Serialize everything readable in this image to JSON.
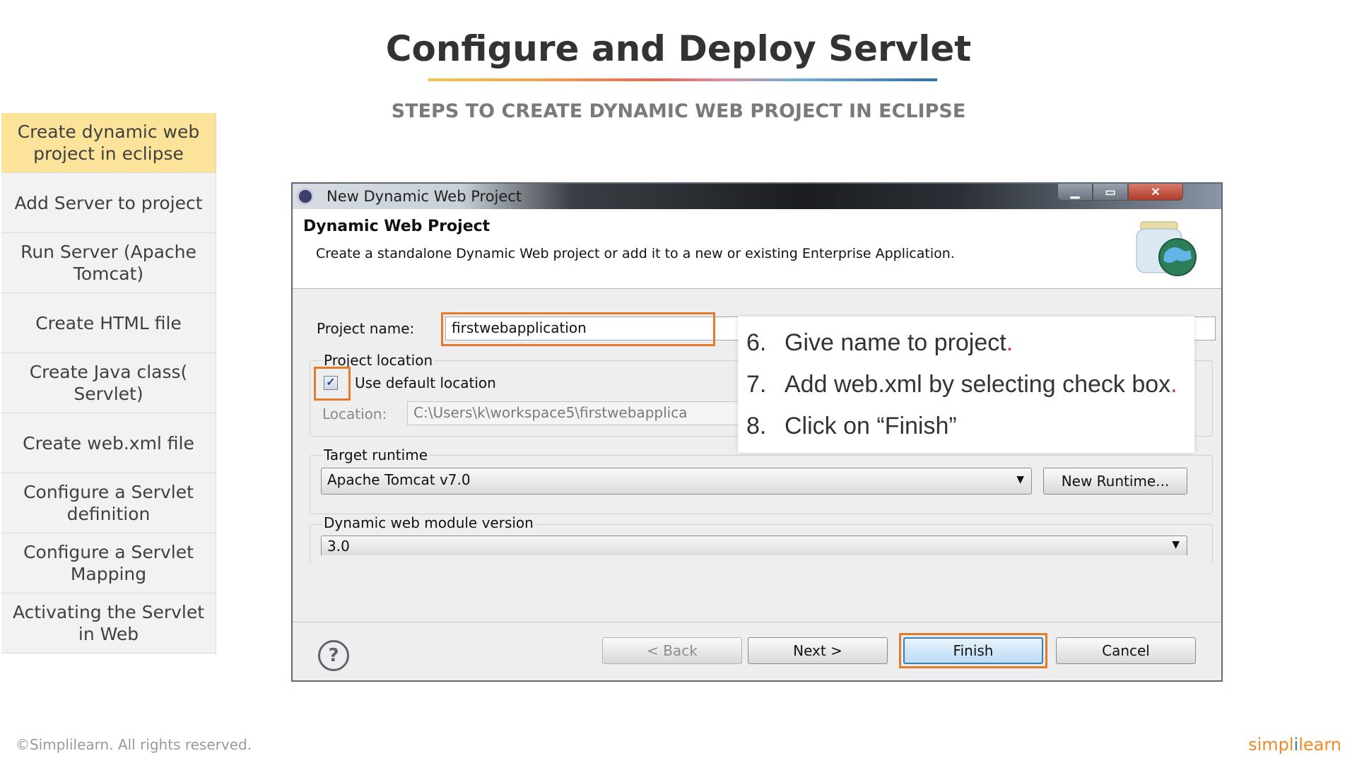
{
  "slide": {
    "title": "Configure and Deploy Servlet",
    "subtitle": "STEPS TO CREATE DYNAMIC WEB PROJECT IN ECLIPSE"
  },
  "steps": [
    {
      "label": "Create dynamic web project in eclipse",
      "active": true
    },
    {
      "label": "Add Server to project"
    },
    {
      "label": "Run Server (Apache Tomcat)"
    },
    {
      "label": "Create HTML file"
    },
    {
      "label": "Create Java class( Servlet)"
    },
    {
      "label": "Create web.xml file"
    },
    {
      "label": "Configure a Servlet definition"
    },
    {
      "label": "Configure a Servlet Mapping"
    },
    {
      "label": "Activating the Servlet in Web"
    }
  ],
  "dialog": {
    "window_title": "New Dynamic Web Project",
    "header_title": "Dynamic Web Project",
    "header_desc": "Create a standalone Dynamic Web project or add it to a new or existing Enterprise Application.",
    "project_name_label": "Project name:",
    "project_name_value": "firstwebapplication",
    "project_location_label": "Project location",
    "use_default_label": "Use default location",
    "use_default_checked": true,
    "location_label": "Location:",
    "location_value": "C:\\Users\\k\\workspace5\\firstwebapplica",
    "target_runtime_label": "Target runtime",
    "target_runtime_value": "Apache Tomcat v7.0",
    "new_runtime_button": "New Runtime...",
    "module_version_label": "Dynamic web module version",
    "module_version_value": "3.0",
    "buttons": {
      "back": "< Back",
      "next": "Next >",
      "finish": "Finish",
      "cancel": "Cancel"
    },
    "help_glyph": "?"
  },
  "callout": [
    {
      "num": "6.",
      "text": "Give name to project"
    },
    {
      "num": "7.",
      "text": "Add web.xml by selecting check box"
    },
    {
      "num": "8.",
      "text": "Click on “Finish”"
    }
  ],
  "footer": {
    "copyright": "©Simplilearn. All rights reserved.",
    "brand_part1": "simpl",
    "brand_part2": "i",
    "brand_part3": "learn"
  },
  "colors": {
    "highlight": "#e57a2d",
    "active_step": "#fbe49a",
    "brand_orange": "#f08a24",
    "brand_blue": "#2b7fc1"
  }
}
